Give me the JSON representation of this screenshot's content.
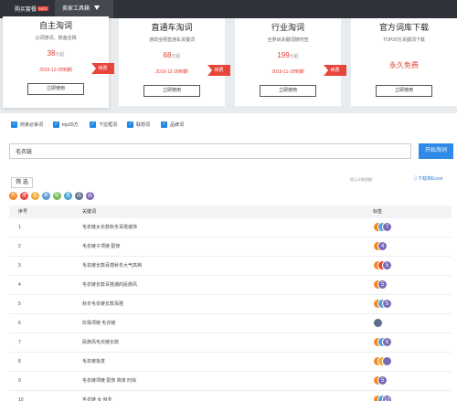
{
  "topnav": {
    "buy_label": "购买套餐",
    "hot_badge": "HOT",
    "tools_label": "卖家工具箱"
  },
  "cards": [
    {
      "title": "自主淘词",
      "desc": "以词搜词，搜遍全网",
      "price": "38",
      "price_unit": "元起",
      "expire": "2019-12-28到期",
      "renew": "续费",
      "button": "立即使用"
    },
    {
      "title": "直通车淘词",
      "desc": "通现全网直通车关键词",
      "price": "68",
      "price_unit": "元起",
      "expire": "2019-12-28到期",
      "renew": "续费",
      "button": "立即使用"
    },
    {
      "title": "行业淘词",
      "desc": "全类目关键词随时查",
      "price": "199",
      "price_unit": "元起",
      "expire": "2019-11-28到期",
      "renew": "续费",
      "button": "立即使用"
    },
    {
      "title": "官方词库下载",
      "desc": "TOP20万关键词下载",
      "free": "永久免费",
      "button": "立即使用"
    }
  ],
  "filters": [
    "商家必争词",
    "top20万",
    "下拉框词",
    "联想词",
    "品牌词"
  ],
  "search": {
    "value": "毛衣链",
    "button": "开始淘词"
  },
  "toolbar": {
    "filter_button": "筛 选",
    "hint": "提示次数限额：",
    "excel_link": "下载到Excel"
  },
  "tag_legend": [
    {
      "icon": "热",
      "color": "#f08a24"
    },
    {
      "icon": "搜",
      "color": "#e8463c"
    },
    {
      "icon": "蓝",
      "color": "#f0a630"
    },
    {
      "icon": "新",
      "color": "#5c9bd5"
    },
    {
      "icon": "联",
      "color": "#76b852"
    },
    {
      "icon": "直",
      "color": "#4aa3d8"
    },
    {
      "icon": "品",
      "color": "#5a6f8a"
    },
    {
      "icon": "品",
      "color": "#7b68b5"
    }
  ],
  "table": {
    "headers": [
      "序号",
      "关键词",
      "标签"
    ],
    "rows": [
      {
        "no": "1",
        "keyword": "毛衣链女长款秋冬百搭装饰",
        "tags": [
          {
            "g": "",
            "c": "#f08a24"
          },
          {
            "g": "",
            "c": "#5c9bd5"
          },
          {
            "g": "7",
            "c": "#7b68b5"
          }
        ]
      },
      {
        "no": "2",
        "keyword": "毛衣链子项链 配饰",
        "tags": [
          {
            "g": "",
            "c": "#f08a24"
          },
          {
            "g": "4",
            "c": "#7b68b5"
          }
        ]
      },
      {
        "no": "3",
        "keyword": "毛衣链长款百搭秋冬大气高档",
        "tags": [
          {
            "g": "",
            "c": "#f08a24"
          },
          {
            "g": "",
            "c": "#e8463c"
          },
          {
            "g": "5",
            "c": "#7b68b5"
          }
        ]
      },
      {
        "no": "4",
        "keyword": "毛衣链长款百搭潮的民族风",
        "tags": [
          {
            "g": "",
            "c": "#f08a24"
          },
          {
            "g": "5",
            "c": "#7b68b5"
          }
        ]
      },
      {
        "no": "5",
        "keyword": "秋冬毛衣链长款百搭",
        "tags": [
          {
            "g": "",
            "c": "#f08a24"
          },
          {
            "g": "",
            "c": "#5c9bd5"
          },
          {
            "g": "5",
            "c": "#7b68b5"
          }
        ]
      },
      {
        "no": "6",
        "keyword": "珍珠项链 毛衣链",
        "tags": [
          {
            "g": "",
            "c": "#5a6f8a"
          }
        ]
      },
      {
        "no": "7",
        "keyword": "民族风毛衣链长款",
        "tags": [
          {
            "g": "",
            "c": "#f08a24"
          },
          {
            "g": "",
            "c": "#5c9bd5"
          },
          {
            "g": "6",
            "c": "#7b68b5"
          }
        ]
      },
      {
        "no": "8",
        "keyword": "毛衣链批发",
        "tags": [
          {
            "g": "",
            "c": "#f08a24"
          },
          {
            "g": "",
            "c": "#f0a630"
          },
          {
            "g": "",
            "c": "#7b68b5"
          }
        ]
      },
      {
        "no": "9",
        "keyword": "毛衣链项链 配饰 简单 时尚",
        "tags": [
          {
            "g": "",
            "c": "#f08a24"
          },
          {
            "g": "5",
            "c": "#7b68b5"
          }
        ]
      },
      {
        "no": "10",
        "keyword": "毛衣链 女 秋冬",
        "tags": [
          {
            "g": "",
            "c": "#f08a24"
          },
          {
            "g": "",
            "c": "#5c9bd5"
          },
          {
            "g": "10",
            "c": "#7b68b5"
          }
        ]
      }
    ]
  }
}
